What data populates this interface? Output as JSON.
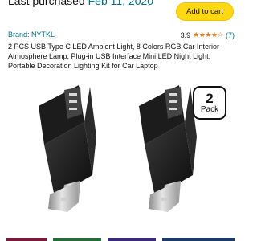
{
  "header": {
    "delivery_prefix": "Last purchased",
    "delivery_date": "Feb 11, 2020",
    "add_to_cart_label": "Add to cart"
  },
  "product": {
    "brand": "Brand: NYTKL",
    "rating_value": "3.9",
    "rating_stars": 3.9,
    "stars_display": "★★★★☆",
    "review_count": "(7)",
    "title": "2 PCS USB Type C LED Ambient Light, 8 Colors RGB Car Interior Atmosphere Lamp, Plug-in USB Interface Mini LED Night Light, Portable Decoration Lighting Kit for Car Laptop",
    "pack_number": "2",
    "pack_label": "Pack"
  },
  "colors": {
    "link": "#007185",
    "button": "#ffd814",
    "star": "#de7921"
  }
}
